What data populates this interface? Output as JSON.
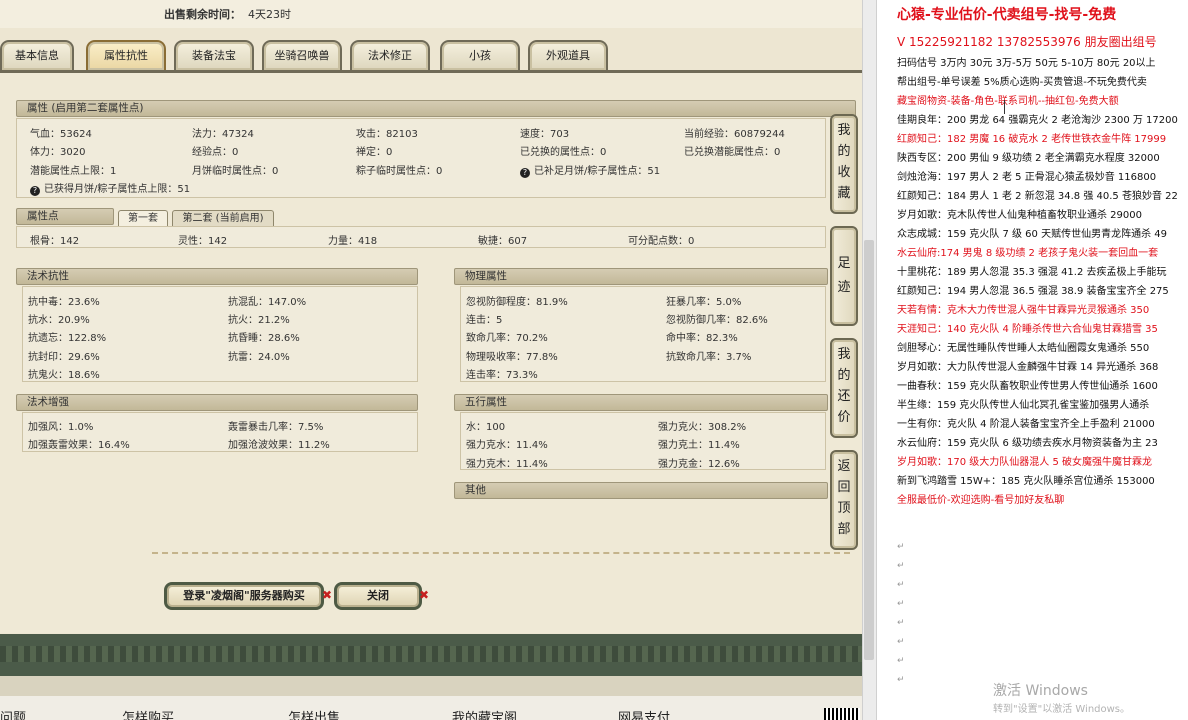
{
  "sale": {
    "label": "出售剩余时间：",
    "value": "4天23时"
  },
  "tabs": [
    "基本信息",
    "属性抗性",
    "装备法宝",
    "坐骑召唤兽",
    "法术修正",
    "小孩",
    "外观道具"
  ],
  "attributes": {
    "title": "属性 (启用第二套属性点)",
    "row1": [
      "气血：53624",
      "法力：47324",
      "攻击：82103",
      "速度：703",
      "当前经验：60879244"
    ],
    "row2": [
      "体力：3020",
      "经验点：0",
      "禅定：0",
      "已兑换的属性点：0",
      "已兑换潜能属性点：0"
    ],
    "row3": [
      "潜能属性点上限：1",
      "月饼临时属性点：0",
      "粽子临时属性点：0",
      "已补足月饼/粽子属性点：51"
    ],
    "row4": "已获得月饼/粽子属性点上限：51"
  },
  "points": {
    "title": "属性点",
    "subtabs": [
      "第一套",
      "第二套 (当前启用)"
    ],
    "values": [
      "根骨：142",
      "灵性：142",
      "力量：418",
      "敏捷：607",
      "可分配点数：0"
    ]
  },
  "magic_resist": {
    "title": "法术抗性",
    "left": [
      "抗中毒：23.6%",
      "抗水：20.9%",
      "抗遗忘：122.8%",
      "抗封印：29.6%",
      "抗鬼火：18.6%"
    ],
    "right": [
      "抗混乱：147.0%",
      "抗火：21.2%",
      "抗昏睡：28.6%",
      "抗雷：24.0%"
    ]
  },
  "physical": {
    "title": "物理属性",
    "left": [
      "忽视防御程度：81.9%",
      "连击：5",
      "致命几率：70.2%",
      "物理吸收率：77.8%",
      "连击率：73.3%"
    ],
    "right": [
      "狂暴几率：5.0%",
      "忽视防御几率：82.6%",
      "命中率：82.3%",
      "抗致命几率：3.7%"
    ]
  },
  "magic_boost": {
    "title": "法术增强",
    "left": [
      "加强风：1.0%",
      "加强轰雷效果：16.4%"
    ],
    "right": [
      "轰雷暴击几率：7.5%",
      "加强沧波效果：11.2%"
    ]
  },
  "five_elements": {
    "title": "五行属性",
    "left": [
      "水：100",
      "强力克水：11.4%",
      "强力克木：11.4%"
    ],
    "right": [
      "强力克火：308.2%",
      "强力克土：11.4%",
      "强力克金：12.6%"
    ]
  },
  "other": {
    "title": "其他"
  },
  "side_buttons": [
    "我的收藏",
    "足迹",
    "我的还价",
    "返回顶部"
  ],
  "actions": {
    "login_buy": "登录\"凌烟阁\"服务器购买",
    "close": "关闭"
  },
  "footer": [
    "问题",
    "怎样购买",
    "怎样出售",
    "我的藏宝阁",
    "网易支付"
  ],
  "doc": {
    "title": "心猿-专业估价-代卖组号-找号-免费",
    "contact": "V 15225921182   13782553976 朋友圈出组号",
    "lines": [
      {
        "text": "扫码估号 3万内 30元 3万-5万 50元 5-10万 80元 20以上",
        "red": false
      },
      {
        "text": "帮出组号-单号误差 5%质心选购-买贵管退-不玩免费代卖",
        "red": false
      },
      {
        "text": "藏宝阁物资-装备-角色-联系司机--抽红包-免费大额",
        "red": true
      },
      {
        "text": "佳期良年：200 男龙 64 强霸克火 2 老沧淘沙 2300 万 17200",
        "red": false
      },
      {
        "text": "红颜知己：182 男魔 16 破克水 2 老传世铁衣金牛阵 17999",
        "red": true
      },
      {
        "text": "陕西专区：200 男仙 9 级功绩 2 老全满霸克水程度 32000",
        "red": false
      },
      {
        "text": "剑烛沧海：197 男人 2 老 5 正骨混心猿孟极妙音 116800",
        "red": false
      },
      {
        "text": "红颜知己：184 男人 1 老 2 新忽混 34.8 强 40.5 苍狼妙音 22",
        "red": false
      },
      {
        "text": "岁月如歌：克木队传世人仙鬼种植畜牧职业通杀 29000",
        "red": false
      },
      {
        "text": "众志成城：159 克火队 7 级 60 天赋传世仙男青龙阵通杀 49",
        "red": false
      },
      {
        "text": "水云仙府:174 男鬼 8 级功绩 2 老孩子鬼火装一套回血一套",
        "red": true
      },
      {
        "text": "十里桃花：189 男人忽混 35.3 强混 41.2 去疾孟极上手能玩",
        "red": false
      },
      {
        "text": "红颜知己：194 男人忽混 36.5 强混 38.9 装备宝宝齐全 275",
        "red": false
      },
      {
        "text": "天若有情：克木大力传世混人强牛甘霖异光灵猴通杀 350",
        "red": true
      },
      {
        "text": "天涯知己：140 克火队 4 阶睡杀传世六合仙鬼甘霖猎雪 35",
        "red": true
      },
      {
        "text": "剑胆琴心：无属性睡队传世睡人太皓仙圈霞女鬼通杀 550",
        "red": false
      },
      {
        "text": "岁月如歌：大力队传世混人金麟强牛甘霖 14 异光通杀 368",
        "red": false
      },
      {
        "text": "一曲春秋：159 克火队畜牧职业传世男人传世仙通杀 1600",
        "red": false
      },
      {
        "text": "半生缘：159 克火队传世人仙北冥孔雀宝鉴加强男人通杀",
        "red": false
      },
      {
        "text": "一生有你：克火队 4 阶混人装备宝宝齐全上手盈利 21000",
        "red": false
      },
      {
        "text": "水云仙府：159 克火队 6 级功绩去疾水月物资装备为主 23",
        "red": false
      },
      {
        "text": "岁月如歌：170 级大力队仙器混人 5 破女魔强牛魔甘霖龙",
        "red": true
      },
      {
        "text": "新到飞鸿踏雪 15W+：185 克火队睡杀宫位通杀 153000",
        "red": false
      },
      {
        "text": "全服最低价-欢迎选购-看号加好友私聊",
        "red": true
      }
    ],
    "activate_title": "激活 Windows",
    "activate_sub": "转到\"设置\"以激活 Windows。"
  }
}
